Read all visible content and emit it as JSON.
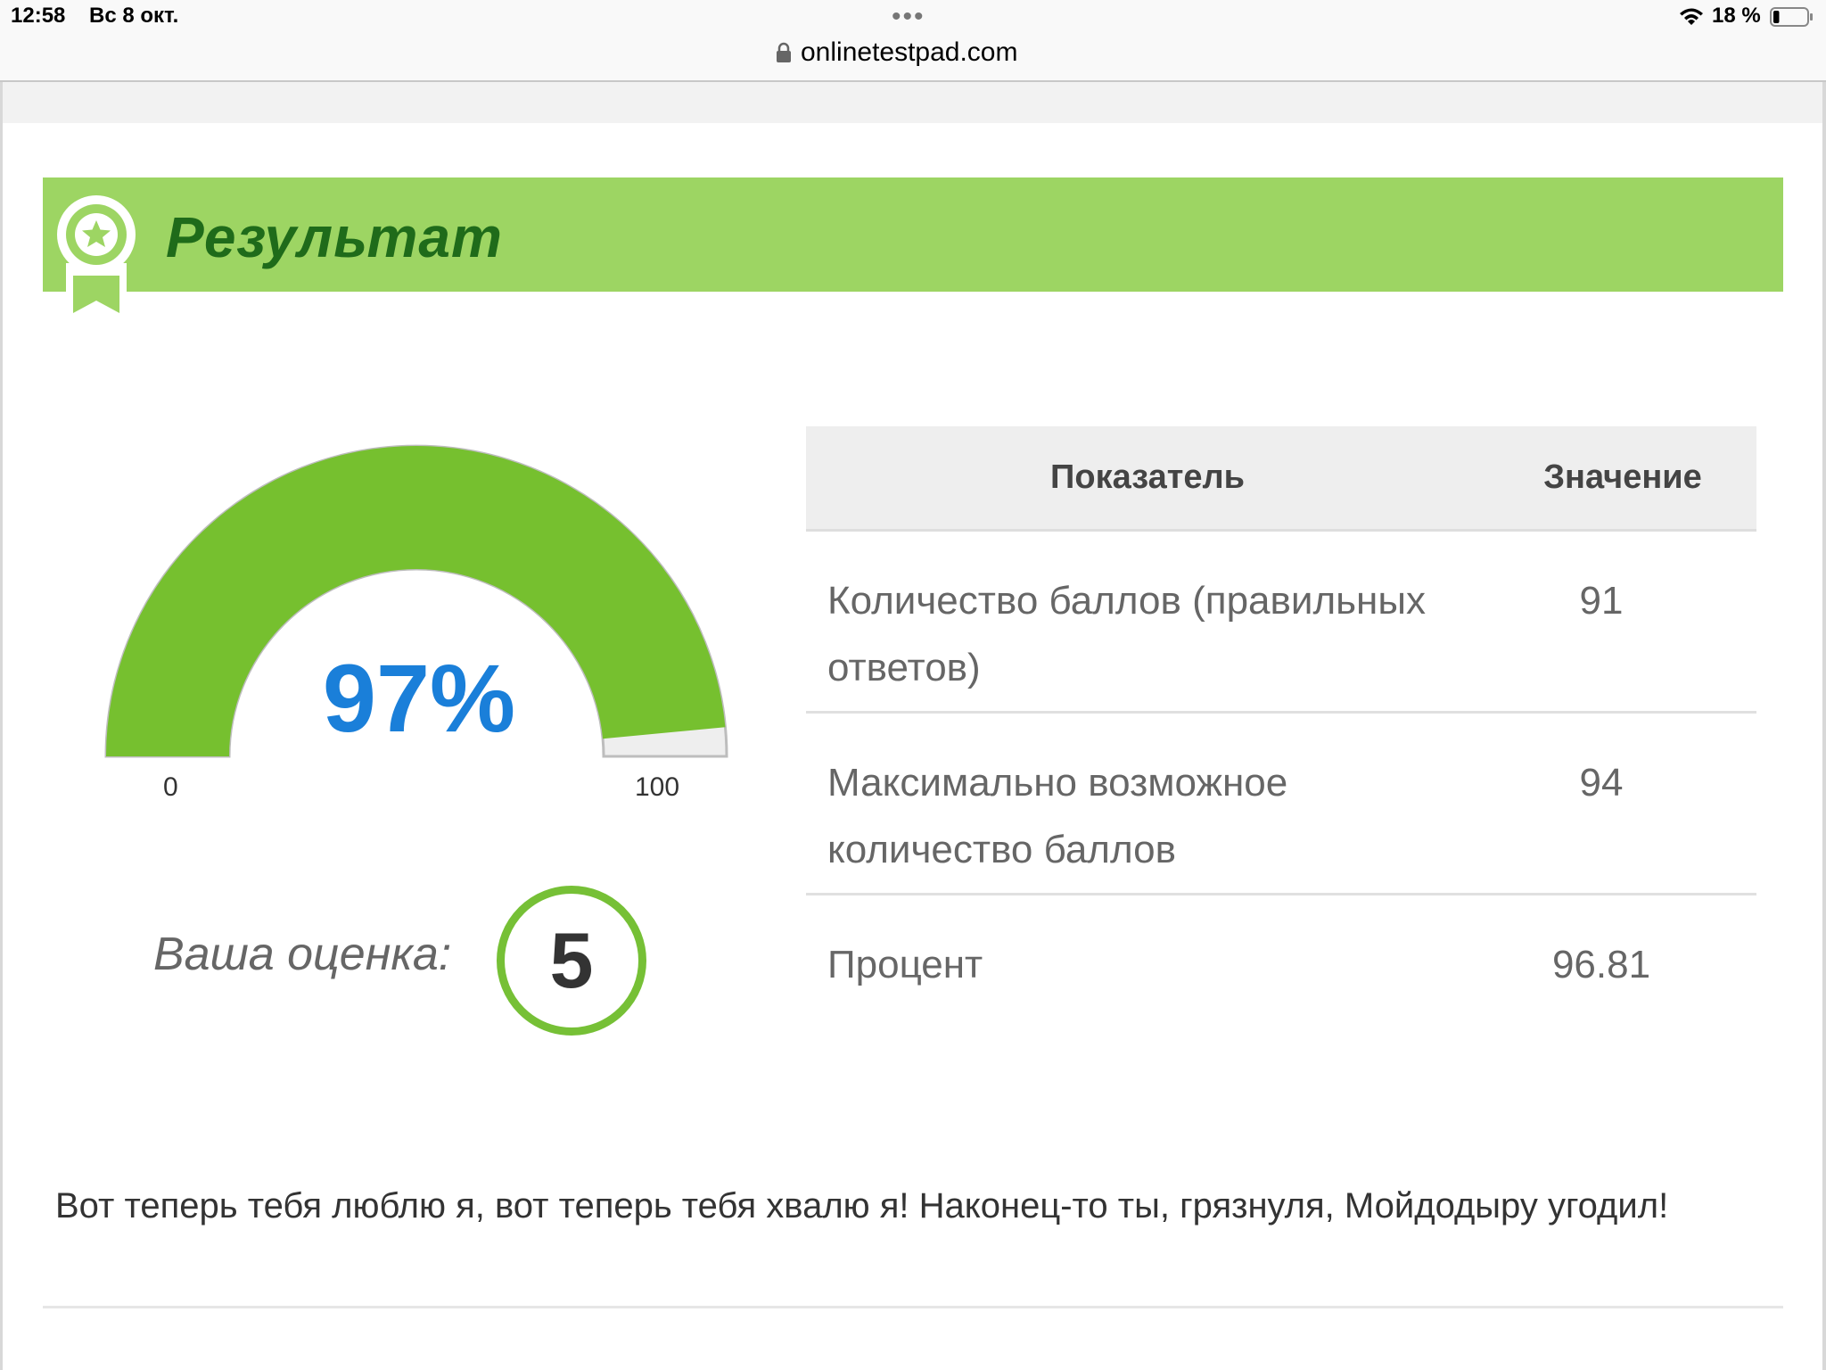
{
  "status_bar": {
    "time": "12:58",
    "date": "Вс 8 окт.",
    "battery_percent": "18 %",
    "battery_level": 0.18
  },
  "browser": {
    "url": "onlinetestpad.com"
  },
  "banner": {
    "title": "Результат",
    "color": "#9dd563",
    "title_color": "#1f6b1a",
    "icon": "award-ribbon-icon"
  },
  "gauge": {
    "value_label": "97%",
    "min_label": "0",
    "max_label": "100",
    "fill_fraction": 0.97,
    "fill_color": "#76c02f",
    "value_color": "#1a7fd9"
  },
  "grade": {
    "label": "Ваша оценка:",
    "value": "5",
    "ring_color": "#76c036"
  },
  "stats_table": {
    "header": {
      "indicator": "Показатель",
      "value": "Значение"
    },
    "rows": [
      {
        "indicator": "Количество баллов (правильных ответов)",
        "value": "91"
      },
      {
        "indicator": "Максимально возможное количество баллов",
        "value": "94"
      },
      {
        "indicator": "Процент",
        "value": "96.81"
      }
    ]
  },
  "message": "Вот теперь тебя люблю я, вот теперь тебя хвалю я! Наконец-то ты, грязнуля, Мойдодыру угодил!"
}
